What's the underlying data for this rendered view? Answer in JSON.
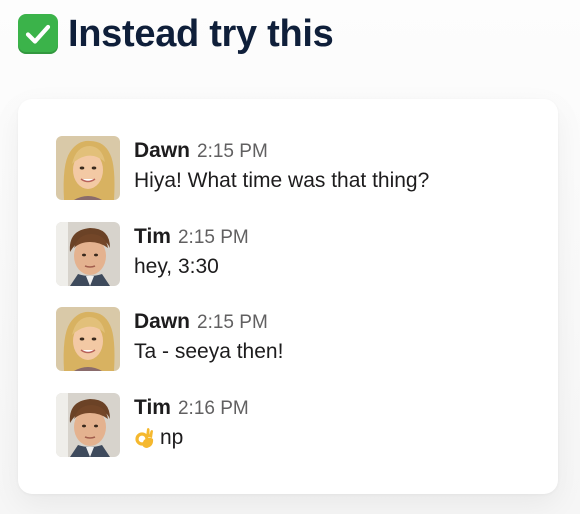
{
  "header": {
    "title": "Instead try this",
    "icon": "check-mark-button-icon",
    "badge_color": "#3bb34a"
  },
  "messages": [
    {
      "author": "Dawn",
      "time": "2:15 PM",
      "text": "Hiya! What time was that thing?",
      "avatar": "dawn-avatar"
    },
    {
      "author": "Tim",
      "time": "2:15 PM",
      "text": "hey, 3:30",
      "avatar": "tim-avatar"
    },
    {
      "author": "Dawn",
      "time": "2:15 PM",
      "text": "Ta - seeya then!",
      "avatar": "dawn-avatar"
    },
    {
      "author": "Tim",
      "time": "2:16 PM",
      "text": "np",
      "emoji": "ok-hand-icon",
      "avatar": "tim-avatar"
    }
  ]
}
